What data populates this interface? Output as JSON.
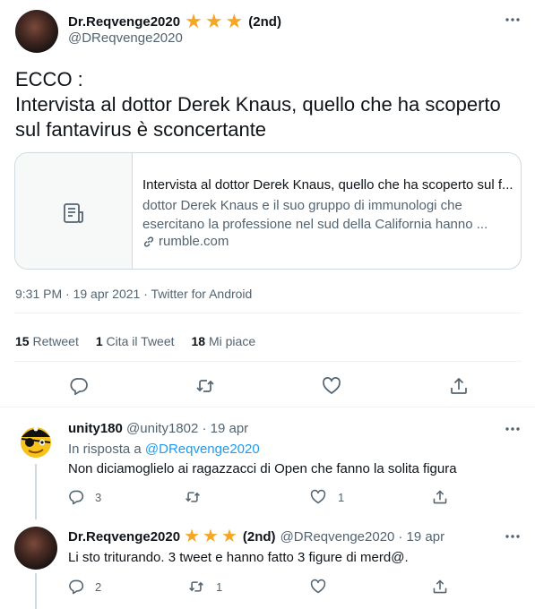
{
  "tweet": {
    "display_name": "Dr.Reqvenge2020",
    "rank": "(2nd)",
    "handle": "@DReqvenge2020",
    "text_line1": "ECCO :",
    "text_line2": "Intervista al dottor Derek Knaus, quello che ha scoperto",
    "text_line3": "sul fantavirus è sconcertante",
    "card": {
      "title": "Intervista al dottor Derek Knaus, quello che ha scoperto sul f...",
      "desc_line1": "dottor Derek Knaus e il suo gruppo di immunologi che",
      "desc_line2": "esercitano la professione nel sud della California hanno ...",
      "domain": "rumble.com"
    },
    "meta": "9:31 PM · 19 apr 2021 · Twitter for Android",
    "stats": {
      "retweets_count": "15",
      "retweets_label": "Retweet",
      "quotes_count": "1",
      "quotes_label": "Cita il Tweet",
      "likes_count": "18",
      "likes_label": "Mi piace"
    }
  },
  "replies": [
    {
      "display_name": "unity180",
      "handle": "@unity1802",
      "time": "· 19 apr",
      "reply_to_label": "In risposta a",
      "reply_to_handle": "@DReqvenge2020",
      "text": "Non diciamoglielo ai ragazzacci di Open che fanno la solita figura",
      "reply_count": "3",
      "retweet_count": "",
      "like_count": "1"
    },
    {
      "display_name": "Dr.Reqvenge2020",
      "rank": "(2nd)",
      "handle": "@DReqvenge2020",
      "time": "· 19 apr",
      "text": "Li sto triturando. 3 tweet e hanno fatto 3 figure di merd@.",
      "reply_count": "2",
      "retweet_count": "1",
      "like_count": ""
    }
  ],
  "icons": {
    "more": "more-icon",
    "reply": "reply-icon",
    "retweet": "retweet-icon",
    "like": "like-icon",
    "share": "share-icon",
    "article": "article-icon",
    "link": "link-icon",
    "star": "star-icon"
  },
  "colors": {
    "accent": "#1d9bf0",
    "star": "#f5a623",
    "muted": "#536471",
    "text": "#0f1419"
  }
}
